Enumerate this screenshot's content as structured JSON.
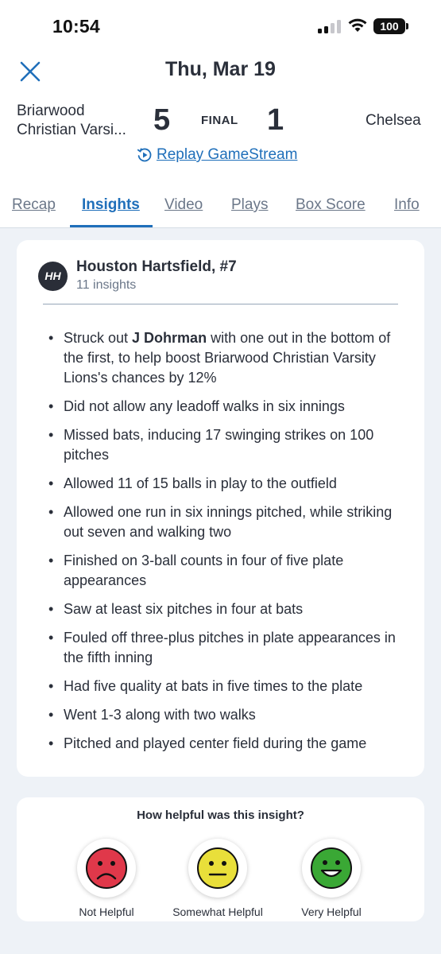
{
  "status_bar": {
    "time": "10:54",
    "battery": "100"
  },
  "header": {
    "date": "Thu, Mar 19"
  },
  "game": {
    "home_team_line1": "Briarwood",
    "home_team_line2": "Christian Varsi...",
    "home_score": "5",
    "status": "FINAL",
    "away_score": "1",
    "away_team": "Chelsea",
    "replay_label": "Replay GameStream"
  },
  "tabs": [
    {
      "label": "Recap"
    },
    {
      "label": "Insights"
    },
    {
      "label": "Video"
    },
    {
      "label": "Plays"
    },
    {
      "label": "Box Score"
    },
    {
      "label": "Info"
    }
  ],
  "player": {
    "initials": "HH",
    "name": "Houston Hartsfield, #7",
    "insight_count": "11 insights"
  },
  "insights": [
    {
      "before": "Struck out ",
      "bold": "J Dohrman",
      "after": " with one out in the bottom of the first, to help boost Briarwood Christian Varsity Lions's chances by 12%"
    },
    {
      "text": "Did not allow any leadoff walks in six innings"
    },
    {
      "text": "Missed bats, inducing 17 swinging strikes on 100 pitches"
    },
    {
      "text": "Allowed 11 of 15 balls in play to the outfield"
    },
    {
      "text": "Allowed one run in six innings pitched, while striking out seven and walking two"
    },
    {
      "text": "Finished on 3-ball counts in four of five plate appearances"
    },
    {
      "text": "Saw at least six pitches in four at bats"
    },
    {
      "text": "Fouled off three-plus pitches in plate appearances in the fifth inning"
    },
    {
      "text": "Had five quality at bats in five times to the plate"
    },
    {
      "text": "Went 1-3 along with two walks"
    },
    {
      "text": "Pitched and played center field during the game"
    }
  ],
  "feedback": {
    "question": "How helpful was this insight?",
    "options": [
      {
        "label": "Not Helpful",
        "icon": "sad-face-icon",
        "color": "#e0384a"
      },
      {
        "label": "Somewhat Helpful",
        "icon": "neutral-face-icon",
        "color": "#e9df3a"
      },
      {
        "label": "Very Helpful",
        "icon": "happy-face-icon",
        "color": "#3aa835"
      }
    ]
  },
  "colors": {
    "accent": "#1f6fba",
    "background": "#eef2f7",
    "text": "#2a2f3a"
  }
}
